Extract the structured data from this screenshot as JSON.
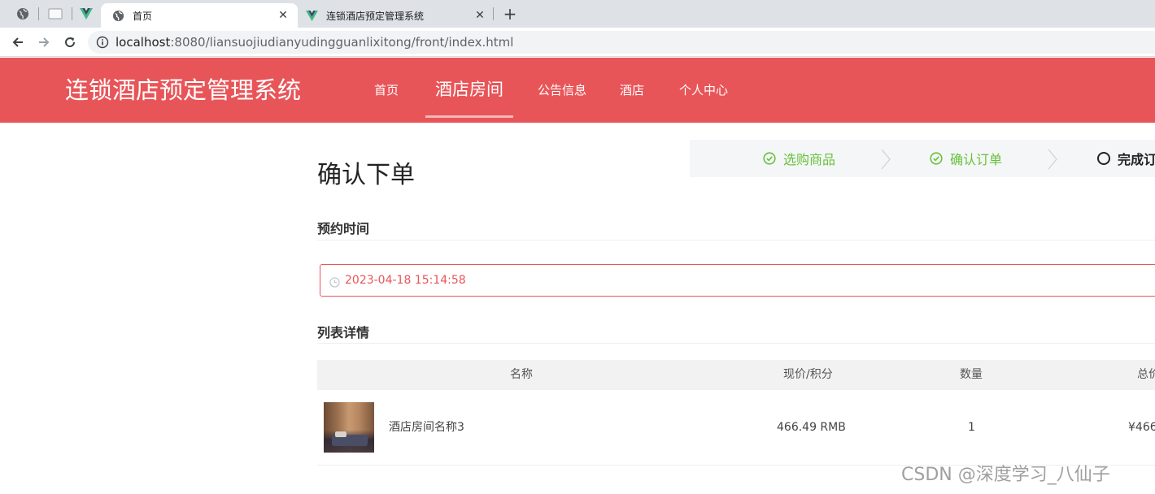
{
  "browser": {
    "tabs": [
      {
        "title": "首页",
        "active": true
      },
      {
        "title": "连锁酒店预定管理系统",
        "active": false
      }
    ],
    "url_host": "localhost",
    "url_rest": ":8080/liansuojiudianyudingguanlixitong/front/index.html"
  },
  "header": {
    "site_title": "连锁酒店预定管理系统",
    "nav": [
      {
        "label": "首页"
      },
      {
        "label": "酒店房间",
        "active": true
      },
      {
        "label": "公告信息"
      },
      {
        "label": "酒店"
      },
      {
        "label": "个人中心"
      }
    ]
  },
  "main": {
    "heading": "确认下单",
    "steps": [
      {
        "label": "选购商品",
        "status": "done"
      },
      {
        "label": "确认订单",
        "status": "done"
      },
      {
        "label": "完成订",
        "status": "current"
      }
    ],
    "reserve_section_title": "预约时间",
    "reserve_datetime": "2023-04-18 15:14:58",
    "list_section_title": "列表详情",
    "table": {
      "headers": [
        "名称",
        "现价/积分",
        "数量",
        "总价"
      ],
      "rows": [
        {
          "name": "酒店房间名称3",
          "price": "466.49 RMB",
          "qty": "1",
          "total": "¥466"
        }
      ]
    }
  },
  "watermark": "CSDN @深度学习_八仙子",
  "colors": {
    "brand": "#e85558",
    "success": "#67c23a"
  }
}
